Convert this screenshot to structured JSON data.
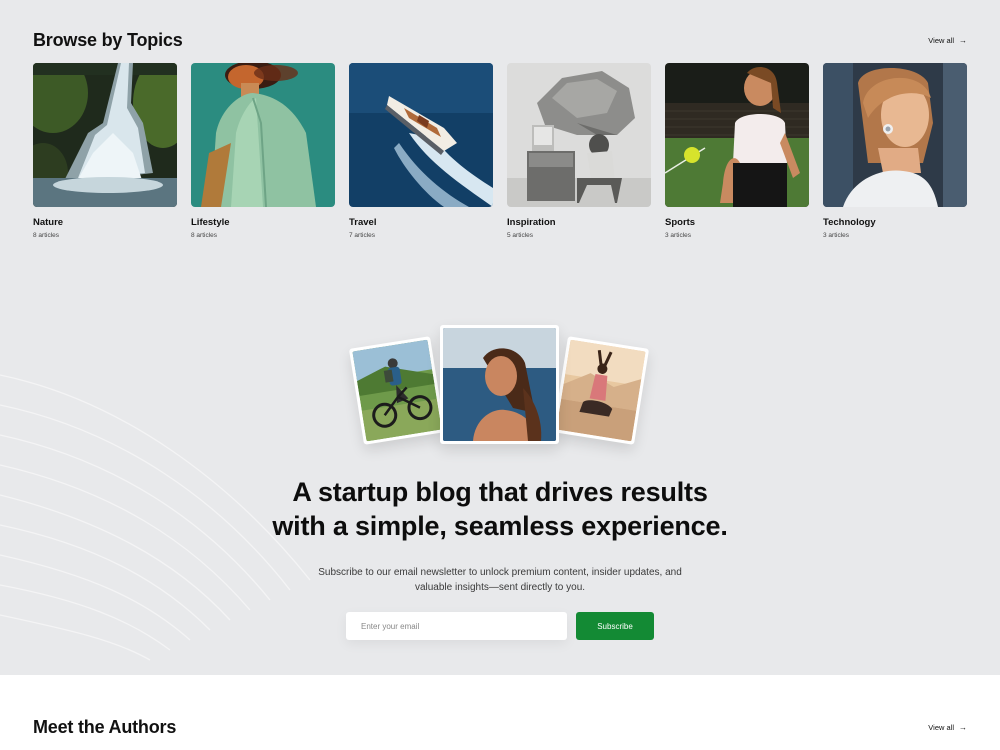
{
  "topics_section": {
    "title": "Browse by Topics",
    "view_all": "View all",
    "arrow_icon": "arrow-right-icon",
    "items": [
      {
        "name": "Nature",
        "count": "8 articles",
        "image": "waterfall"
      },
      {
        "name": "Lifestyle",
        "count": "8 articles",
        "image": "person-green-jacket"
      },
      {
        "name": "Travel",
        "count": "7 articles",
        "image": "speedboat"
      },
      {
        "name": "Inspiration",
        "count": "5 articles",
        "image": "rock-over-desk"
      },
      {
        "name": "Sports",
        "count": "3 articles",
        "image": "tennis-player"
      },
      {
        "name": "Technology",
        "count": "3 articles",
        "image": "woman-earbuds"
      }
    ]
  },
  "hero": {
    "title_line1": "A startup blog that drives results",
    "title_line2": "with a simple, seamless experience.",
    "subtitle": "Subscribe to our email newsletter to unlock premium content, insider updates, and valuable insights—sent directly to you.",
    "email_placeholder": "Enter your email",
    "email_value": "",
    "subscribe_label": "Subscribe",
    "photos": [
      "cyclist",
      "woman-sea",
      "yoga"
    ]
  },
  "authors_section": {
    "title": "Meet the Authors",
    "view_all": "View all"
  },
  "colors": {
    "background": "#e8e9eb",
    "accent_green": "#138a34",
    "text": "#111111",
    "authors_bg": "#ffffff"
  }
}
